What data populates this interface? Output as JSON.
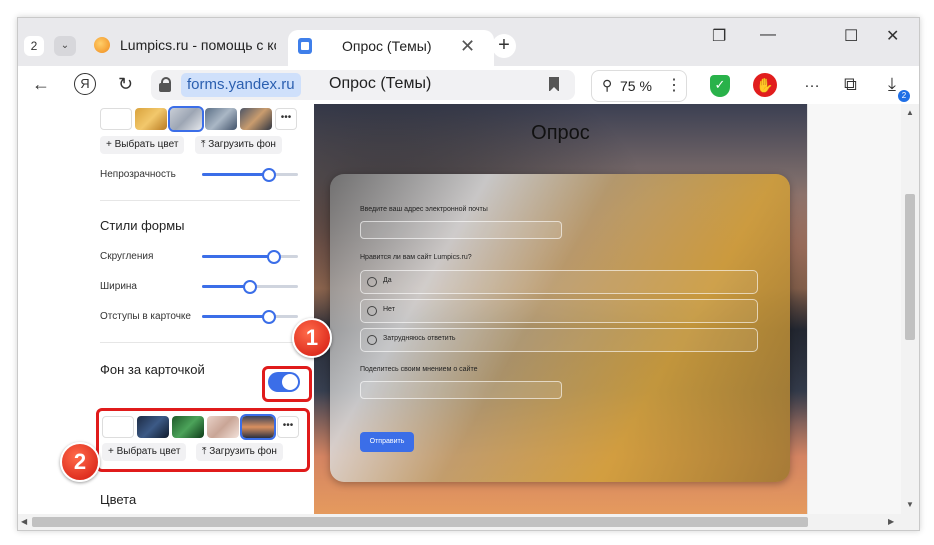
{
  "browser": {
    "tab_count": "2",
    "tabs": [
      {
        "label": "Lumpics.ru - помощь с ком"
      },
      {
        "label": "Опрос (Темы)"
      }
    ],
    "address": {
      "domain": "forms.yandex.ru",
      "title": "Опрос (Темы)"
    },
    "zoom": "75 %",
    "downloads_badge": "2"
  },
  "panel": {
    "upload_color_label": "Выбрать цвет",
    "upload_bg_label": "Загрузить фон",
    "opacity_label": "Непрозрачность",
    "opacity_value": 0.7,
    "form_styles_title": "Стили формы",
    "rounding_label": "Скругления",
    "rounding_value": 0.75,
    "width_label": "Ширина",
    "width_value": 0.5,
    "padding_label": "Отступы в карточке",
    "padding_value": 0.7,
    "card_bg_title": "Фон за карточкой",
    "card_bg_enabled": true,
    "card_bg_color_label": "Выбрать цвет",
    "card_bg_upload_label": "Загрузить фон",
    "colors_title": "Цвета"
  },
  "annotations": {
    "step1": "1",
    "step2": "2"
  },
  "preview": {
    "title": "Опрос",
    "q1": "Введите ваш адрес электронной почты",
    "q2": "Нравится ли вам сайт Lumpics.ru?",
    "options": [
      "Да",
      "Нет",
      "Затрудняюсь ответить"
    ],
    "q3": "Поделитесь своим мнением о сайте",
    "submit": "Отправить"
  },
  "colors": {
    "accent": "#3b6ee8",
    "annotation_red": "#e01b1b"
  }
}
